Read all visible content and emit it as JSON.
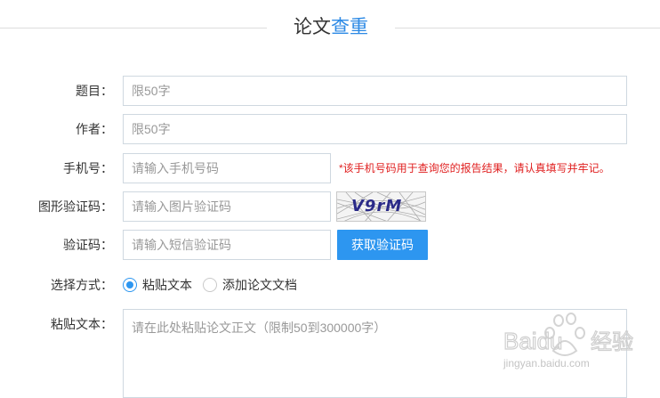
{
  "header": {
    "title_part1": "论文",
    "title_part2": "查重"
  },
  "form": {
    "title": {
      "label": "题目：",
      "placeholder": "限50字"
    },
    "author": {
      "label": "作者：",
      "placeholder": "限50字"
    },
    "phone": {
      "label": "手机号：",
      "placeholder": "请输入手机号码",
      "hint": "*该手机号码用于查询您的报告结果，请认真填写并牢记。"
    },
    "image_code": {
      "label": "图形验证码：",
      "placeholder": "请输入图片验证码",
      "captcha_text": "V9rM"
    },
    "sms_code": {
      "label": "验证码：",
      "placeholder": "请输入短信验证码",
      "button": "获取验证码"
    },
    "mode": {
      "label": "选择方式：",
      "options": [
        {
          "label": "粘贴文本",
          "checked": true
        },
        {
          "label": "添加论文文档",
          "checked": false
        }
      ]
    },
    "paste": {
      "label": "粘贴文本：",
      "placeholder": "请在此处粘贴论文正文（限制50到300000字）"
    }
  },
  "watermark": {
    "brand": "Baidu",
    "brand_cn": "经验",
    "url": "jingyan.baidu.com"
  },
  "colors": {
    "accent": "#2d96f0",
    "title_accent": "#2d8ae5",
    "warning": "#e02020",
    "border": "#cfd8e0"
  }
}
